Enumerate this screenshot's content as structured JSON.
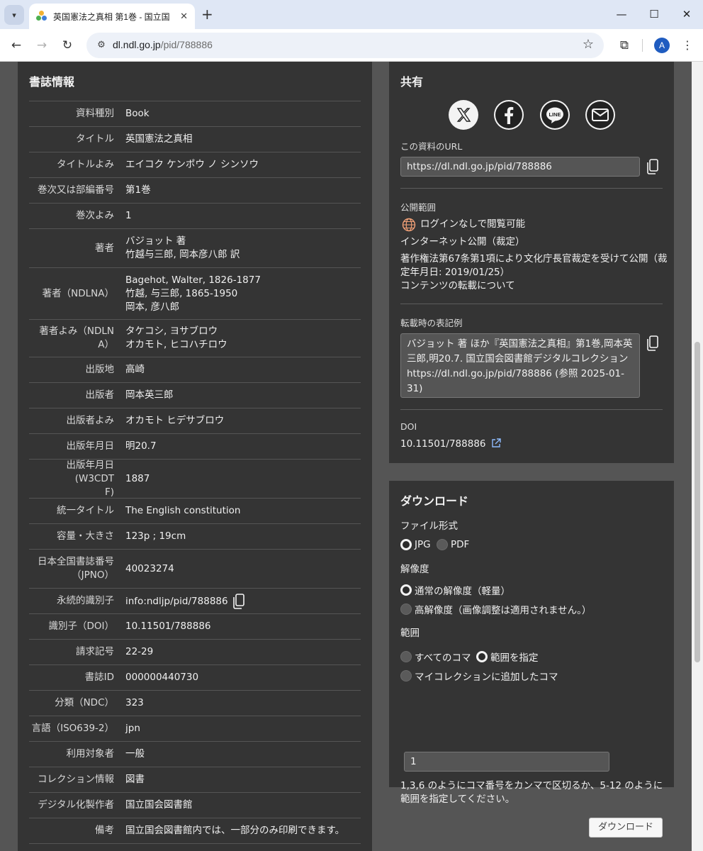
{
  "browser": {
    "tab_title": "英国憲法之真相 第1巻 - 国立国",
    "tab_close": "✕",
    "new_tab": "+",
    "url_host": "dl.ndl.go.jp",
    "url_path": "/pid/788886",
    "profile_initial": "A"
  },
  "bib": {
    "title": "書誌情報",
    "rows": [
      {
        "label": "資料種別",
        "value": [
          "Book"
        ]
      },
      {
        "label": "タイトル",
        "value": [
          "英国憲法之真相"
        ]
      },
      {
        "label": "タイトルよみ",
        "value": [
          "エイコク ケンポウ ノ シンソウ"
        ]
      },
      {
        "label": "巻次又は部編番号",
        "value": [
          "第1巻"
        ]
      },
      {
        "label": "巻次よみ",
        "value": [
          "1"
        ]
      },
      {
        "label": "著者",
        "value": [
          "バジョット 著",
          "竹越与三郎, 岡本彦八郎 訳"
        ]
      },
      {
        "label": "著者（NDLNA）",
        "value": [
          "Bagehot, Walter, 1826-1877",
          "竹越, 与三郎, 1865-1950",
          "岡本, 彦八郎"
        ]
      },
      {
        "label": "著者よみ（NDLNA）",
        "value": [
          "タケコシ, ヨサブロウ",
          "オカモト, ヒコハチロウ"
        ]
      },
      {
        "label": "出版地",
        "value": [
          "高崎"
        ]
      },
      {
        "label": "出版者",
        "value": [
          "岡本英三郎"
        ]
      },
      {
        "label": "出版者よみ",
        "value": [
          "オカモト ヒデサブロウ"
        ]
      },
      {
        "label": "出版年月日",
        "value": [
          "明20.7"
        ]
      },
      {
        "label": "出版年月日(W3CDTF)",
        "value": [
          "1887"
        ]
      },
      {
        "label": "統一タイトル",
        "value": [
          "The English constitution"
        ]
      },
      {
        "label": "容量・大きさ",
        "value": [
          "123p ; 19cm"
        ]
      },
      {
        "label": "日本全国書誌番号（JPNO）",
        "value": [
          "40023274"
        ]
      },
      {
        "label": "永続的識別子",
        "value": [
          "info:ndljp/pid/788886"
        ]
      },
      {
        "label": "識別子（DOI）",
        "value": [
          "10.11501/788886"
        ]
      },
      {
        "label": "請求記号",
        "value": [
          "22-29"
        ]
      },
      {
        "label": "書誌ID",
        "value": [
          "000000440730"
        ]
      },
      {
        "label": "分類（NDC）",
        "value": [
          "323"
        ]
      },
      {
        "label": "言語（ISO639-2）",
        "value": [
          "jpn"
        ]
      },
      {
        "label": "利用対象者",
        "value": [
          "一般"
        ]
      },
      {
        "label": "コレクション情報",
        "value": [
          "図書"
        ]
      },
      {
        "label": "デジタル化製作者",
        "value": [
          "国立国会図書館"
        ]
      },
      {
        "label": "備考",
        "value": [
          "国立国会図書館内では、一部分のみ印刷できます。"
        ]
      }
    ]
  },
  "share": {
    "title": "共有",
    "icons": [
      "x-icon",
      "facebook-icon",
      "line-icon",
      "mail-icon"
    ],
    "line_text": "LINE",
    "url_label": "この資料のURL",
    "url_value": "https://dl.ndl.go.jp/pid/788886",
    "scope_label": "公開範囲",
    "scope_status": "ログインなしで閲覧可能",
    "scope_type": "インターネット公開（裁定）",
    "scope_note_1": "著作権法第67条第1項により文化庁長官裁定を受けて公開（裁",
    "scope_note_2": "定年月日: 2019/01/25）",
    "reprint_link": "コンテンツの転載について",
    "citation_label": "転載時の表記例",
    "citation_lines": [
      "バジョット 著 ほか『英国憲法之真相』第1巻,岡本英",
      "三郎,明20.7. 国立国会図書館デジタルコレクション",
      "https://dl.ndl.go.jp/pid/788886 (参照 2025-01-",
      "31)"
    ],
    "doi_label": "DOI",
    "doi_value": "10.11501/788886"
  },
  "download": {
    "title": "ダウンロード",
    "format_label": "ファイル形式",
    "format_jpg": "JPG",
    "format_pdf": "PDF",
    "res_label": "解像度",
    "res_normal": "通常の解像度（軽量）",
    "res_high": "高解像度（画像調整は適用されません。）",
    "range_label": "範囲",
    "range_all": "すべてのコマ",
    "range_specify": "範囲を指定",
    "range_mycollection": "マイコレクションに追加したコマ",
    "range_value": "1",
    "range_help_1": "1,3,6 のようにコマ番号をカンマで区切るか、5-12 のように",
    "range_help_2": "範囲を指定してください。",
    "button": "ダウンロード"
  },
  "colors": {
    "panel": "#343434",
    "page_bg": "#555555",
    "status_orange": "#f2a177",
    "link_blue": "#8fbbff"
  }
}
